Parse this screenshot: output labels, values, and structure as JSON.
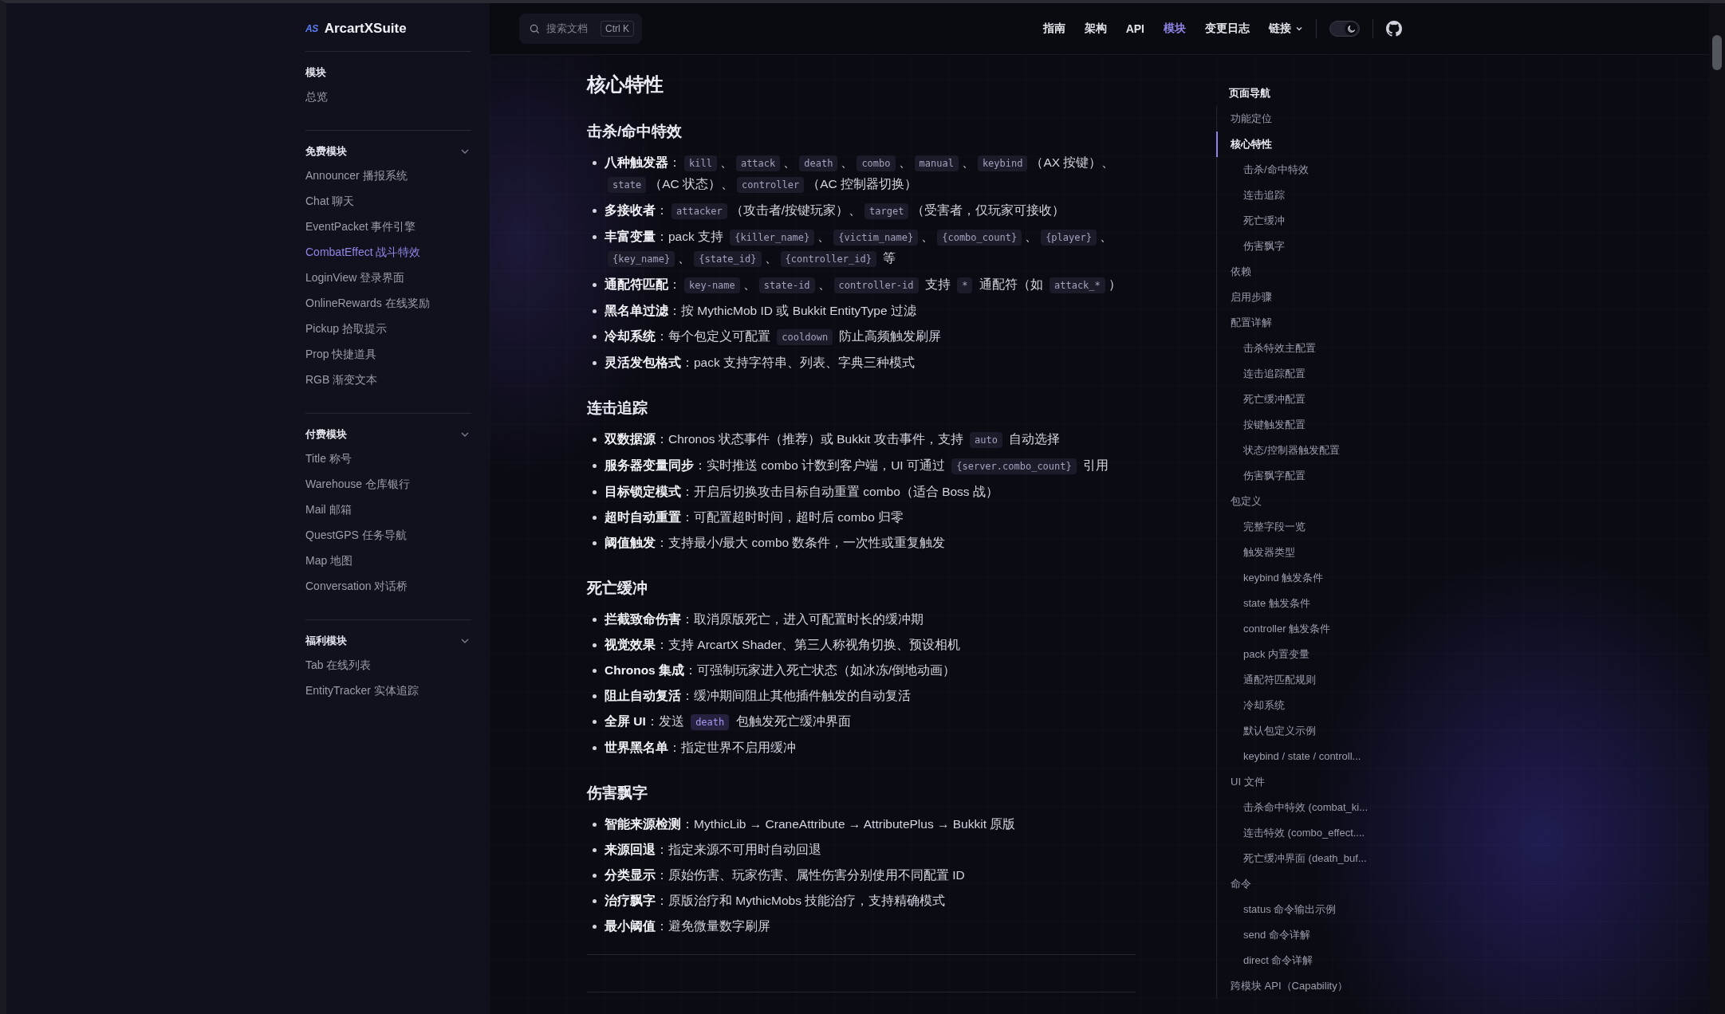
{
  "sidebar": {
    "logo": {
      "badge": "AS",
      "name": "ArcartXSuite"
    },
    "groups": [
      {
        "title": "模块",
        "kind": "plain",
        "items": [
          {
            "label": "总览",
            "selected": false
          }
        ]
      },
      {
        "title": "免费模块",
        "kind": "collapsible",
        "expanded": true,
        "items": [
          {
            "label": "Announcer 播报系统",
            "selected": false
          },
          {
            "label": "Chat 聊天",
            "selected": false
          },
          {
            "label": "EventPacket 事件引擎",
            "selected": false
          },
          {
            "label": "CombatEffect 战斗特效",
            "selected": true
          },
          {
            "label": "LoginView 登录界面",
            "selected": false
          },
          {
            "label": "OnlineRewards 在线奖励",
            "selected": false
          },
          {
            "label": "Pickup 拾取提示",
            "selected": false
          },
          {
            "label": "Prop 快捷道具",
            "selected": false
          },
          {
            "label": "RGB 渐变文本",
            "selected": false
          }
        ]
      },
      {
        "title": "付费模块",
        "kind": "collapsible",
        "expanded": true,
        "items": [
          {
            "label": "Title 称号",
            "selected": false
          },
          {
            "label": "Warehouse 仓库银行",
            "selected": false
          },
          {
            "label": "Mail 邮箱",
            "selected": false
          },
          {
            "label": "QuestGPS 任务导航",
            "selected": false
          },
          {
            "label": "Map 地图",
            "selected": false
          },
          {
            "label": "Conversation 对话桥",
            "selected": false
          }
        ]
      },
      {
        "title": "福利模块",
        "kind": "collapsible",
        "expanded": true,
        "items": [
          {
            "label": "Tab 在线列表",
            "selected": false
          },
          {
            "label": "EntityTracker 实体追踪",
            "selected": false
          }
        ]
      }
    ]
  },
  "topbar": {
    "search": {
      "placeholder": "搜索文档",
      "shortcut": "Ctrl K"
    },
    "nav": [
      {
        "label": "指南",
        "kind": "link",
        "selected": false
      },
      {
        "label": "架构",
        "kind": "link",
        "selected": false
      },
      {
        "label": "API",
        "kind": "link",
        "selected": false
      },
      {
        "label": "模块",
        "kind": "link",
        "selected": true
      },
      {
        "label": "变更日志",
        "kind": "link",
        "selected": false
      },
      {
        "label": "链接",
        "kind": "dropdown",
        "selected": false
      }
    ],
    "theme_toggle": {
      "on": true
    }
  },
  "content": {
    "title": "核心特性",
    "sections": [
      {
        "heading": "击杀/命中特效",
        "items": [
          [
            {
              "kind": "text",
              "text": "**八种触发器**："
            },
            {
              "kind": "code",
              "text": "kill"
            },
            {
              "kind": "text",
              "text": "、"
            },
            {
              "kind": "code",
              "text": "attack"
            },
            {
              "kind": "text",
              "text": "、"
            },
            {
              "kind": "code",
              "text": "death"
            },
            {
              "kind": "text",
              "text": "、"
            },
            {
              "kind": "code",
              "text": "combo"
            },
            {
              "kind": "text",
              "text": "、"
            },
            {
              "kind": "code",
              "text": "manual"
            },
            {
              "kind": "text",
              "text": "、"
            },
            {
              "kind": "code",
              "text": "keybind"
            },
            {
              "kind": "text",
              "text": "（AX 按键）、"
            },
            {
              "kind": "code",
              "text": "state"
            },
            {
              "kind": "text",
              "text": "（AC 状态）、"
            },
            {
              "kind": "code",
              "text": "controller"
            },
            {
              "kind": "text",
              "text": "（AC 控制器切换）"
            }
          ],
          [
            {
              "kind": "text",
              "text": "**多接收者**："
            },
            {
              "kind": "code",
              "text": "attacker"
            },
            {
              "kind": "text",
              "text": "（攻击者/按键玩家）、"
            },
            {
              "kind": "code",
              "text": "target"
            },
            {
              "kind": "text",
              "text": "（受害者，仅玩家可接收）"
            }
          ],
          [
            {
              "kind": "text",
              "text": "**丰富变量**：pack 支持 "
            },
            {
              "kind": "code",
              "text": "{killer_name}"
            },
            {
              "kind": "text",
              "text": "、"
            },
            {
              "kind": "code",
              "text": "{victim_name}"
            },
            {
              "kind": "text",
              "text": "、"
            },
            {
              "kind": "code",
              "text": "{combo_count}"
            },
            {
              "kind": "text",
              "text": "、"
            },
            {
              "kind": "code",
              "text": "{player}"
            },
            {
              "kind": "text",
              "text": "、"
            },
            {
              "kind": "code",
              "text": "{key_name}"
            },
            {
              "kind": "text",
              "text": "、"
            },
            {
              "kind": "code",
              "text": "{state_id}"
            },
            {
              "kind": "text",
              "text": "、"
            },
            {
              "kind": "code",
              "text": "{controller_id}"
            },
            {
              "kind": "text",
              "text": " 等"
            }
          ],
          [
            {
              "kind": "text",
              "text": "**通配符匹配**："
            },
            {
              "kind": "code",
              "text": "key-name"
            },
            {
              "kind": "text",
              "text": "、"
            },
            {
              "kind": "code",
              "text": "state-id"
            },
            {
              "kind": "text",
              "text": "、"
            },
            {
              "kind": "code",
              "text": "controller-id"
            },
            {
              "kind": "text",
              "text": " 支持 "
            },
            {
              "kind": "code",
              "text": "*"
            },
            {
              "kind": "text",
              "text": " 通配符（如 "
            },
            {
              "kind": "code",
              "text": "attack_*"
            },
            {
              "kind": "text",
              "text": "）"
            }
          ],
          [
            {
              "kind": "text",
              "text": "**黑名单过滤**：按 MythicMob ID 或 Bukkit EntityType 过滤"
            }
          ],
          [
            {
              "kind": "text",
              "text": "**冷却系统**：每个包定义可配置 "
            },
            {
              "kind": "code",
              "text": "cooldown"
            },
            {
              "kind": "text",
              "text": " 防止高频触发刷屏"
            }
          ],
          [
            {
              "kind": "text",
              "text": "**灵活发包格式**：pack 支持字符串、列表、字典三种模式"
            }
          ]
        ]
      },
      {
        "heading": "连击追踪",
        "items": [
          [
            {
              "kind": "text",
              "text": "**双数据源**：Chronos 状态事件（推荐）或 Bukkit 攻击事件，支持 "
            },
            {
              "kind": "code",
              "text": "auto"
            },
            {
              "kind": "text",
              "text": " 自动选择"
            }
          ],
          [
            {
              "kind": "text",
              "text": "**服务器变量同步**：实时推送 combo 计数到客户端，UI 可通过 "
            },
            {
              "kind": "code",
              "text": "{server.combo_count}"
            },
            {
              "kind": "text",
              "text": " 引用"
            }
          ],
          [
            {
              "kind": "text",
              "text": "**目标锁定模式**：开启后切换攻击目标自动重置 combo（适合 Boss 战）"
            }
          ],
          [
            {
              "kind": "text",
              "text": "**超时自动重置**：可配置超时时间，超时后 combo 归零"
            }
          ],
          [
            {
              "kind": "text",
              "text": "**阈值触发**：支持最小/最大 combo 数条件，一次性或重复触发"
            }
          ]
        ]
      },
      {
        "heading": "死亡缓冲",
        "items": [
          [
            {
              "kind": "text",
              "text": "**拦截致命伤害**：取消原版死亡，进入可配置时长的缓冲期"
            }
          ],
          [
            {
              "kind": "text",
              "text": "**视觉效果**：支持 ArcartX Shader、第三人称视角切换、预设相机"
            }
          ],
          [
            {
              "kind": "text",
              "text": "**Chronos 集成**：可强制玩家进入死亡状态（如冰冻/倒地动画）"
            }
          ],
          [
            {
              "kind": "text",
              "text": "**阻止自动复活**：缓冲期间阻止其他插件触发的自动复活"
            }
          ],
          [
            {
              "kind": "text",
              "text": "**全屏 UI**：发送 "
            },
            {
              "kind": "code-accent",
              "text": "death"
            },
            {
              "kind": "text",
              "text": " 包触发死亡缓冲界面"
            }
          ],
          [
            {
              "kind": "text",
              "text": "**世界黑名单**：指定世界不启用缓冲"
            }
          ]
        ]
      },
      {
        "heading": "伤害飘字",
        "items": [
          [
            {
              "kind": "text",
              "text": "**智能来源检测**：MythicLib → CraneAttribute → AttributePlus → Bukkit 原版"
            }
          ],
          [
            {
              "kind": "text",
              "text": "**来源回退**：指定来源不可用时自动回退"
            }
          ],
          [
            {
              "kind": "text",
              "text": "**分类显示**：原始伤害、玩家伤害、属性伤害分别使用不同配置 ID"
            }
          ],
          [
            {
              "kind": "text",
              "text": "**治疗飘字**：原版治疗和 MythicMobs 技能治疗，支持精确模式"
            }
          ],
          [
            {
              "kind": "text",
              "text": "**最小阈值**：避免微量数字刷屏"
            }
          ]
        ]
      }
    ]
  },
  "toc": {
    "title": "页面导航",
    "items": [
      {
        "label": "功能定位",
        "selected": false
      },
      {
        "label": "核心特性",
        "selected": true,
        "children": [
          {
            "label": "击杀/命中特效",
            "selected": false
          },
          {
            "label": "连击追踪",
            "selected": false
          },
          {
            "label": "死亡缓冲",
            "selected": false
          },
          {
            "label": "伤害飘字",
            "selected": false
          }
        ]
      },
      {
        "label": "依赖",
        "selected": false
      },
      {
        "label": "启用步骤",
        "selected": false
      },
      {
        "label": "配置详解",
        "selected": false,
        "children": [
          {
            "label": "击杀特效主配置",
            "selected": false
          },
          {
            "label": "连击追踪配置",
            "selected": false
          },
          {
            "label": "死亡缓冲配置",
            "selected": false
          },
          {
            "label": "按键触发配置",
            "selected": false
          },
          {
            "label": "状态/控制器触发配置",
            "selected": false
          },
          {
            "label": "伤害飘字配置",
            "selected": false
          }
        ]
      },
      {
        "label": "包定义",
        "selected": false,
        "children": [
          {
            "label": "完整字段一览",
            "selected": false
          },
          {
            "label": "触发器类型",
            "selected": false
          },
          {
            "label": "keybind 触发条件",
            "selected": false
          },
          {
            "label": "state 触发条件",
            "selected": false
          },
          {
            "label": "controller 触发条件",
            "selected": false
          },
          {
            "label": "pack 内置变量",
            "selected": false
          },
          {
            "label": "通配符匹配规则",
            "selected": false
          },
          {
            "label": "冷却系统",
            "selected": false
          },
          {
            "label": "默认包定义示例",
            "selected": false
          },
          {
            "label": "keybind / state / controll...",
            "selected": false
          }
        ]
      },
      {
        "label": "UI 文件",
        "selected": false,
        "children": [
          {
            "label": "击杀命中特效 (combat_ki...",
            "selected": false
          },
          {
            "label": "连击特效 (combo_effect....",
            "selected": false
          },
          {
            "label": "死亡缓冲界面 (death_buf...",
            "selected": false
          }
        ]
      },
      {
        "label": "命令",
        "selected": false,
        "children": [
          {
            "label": "status 命令输出示例",
            "selected": false
          },
          {
            "label": "send 命令详解",
            "selected": false
          },
          {
            "label": "direct 命令详解",
            "selected": false
          }
        ]
      },
      {
        "label": "跨模块 API（Capability）",
        "selected": false
      }
    ]
  }
}
